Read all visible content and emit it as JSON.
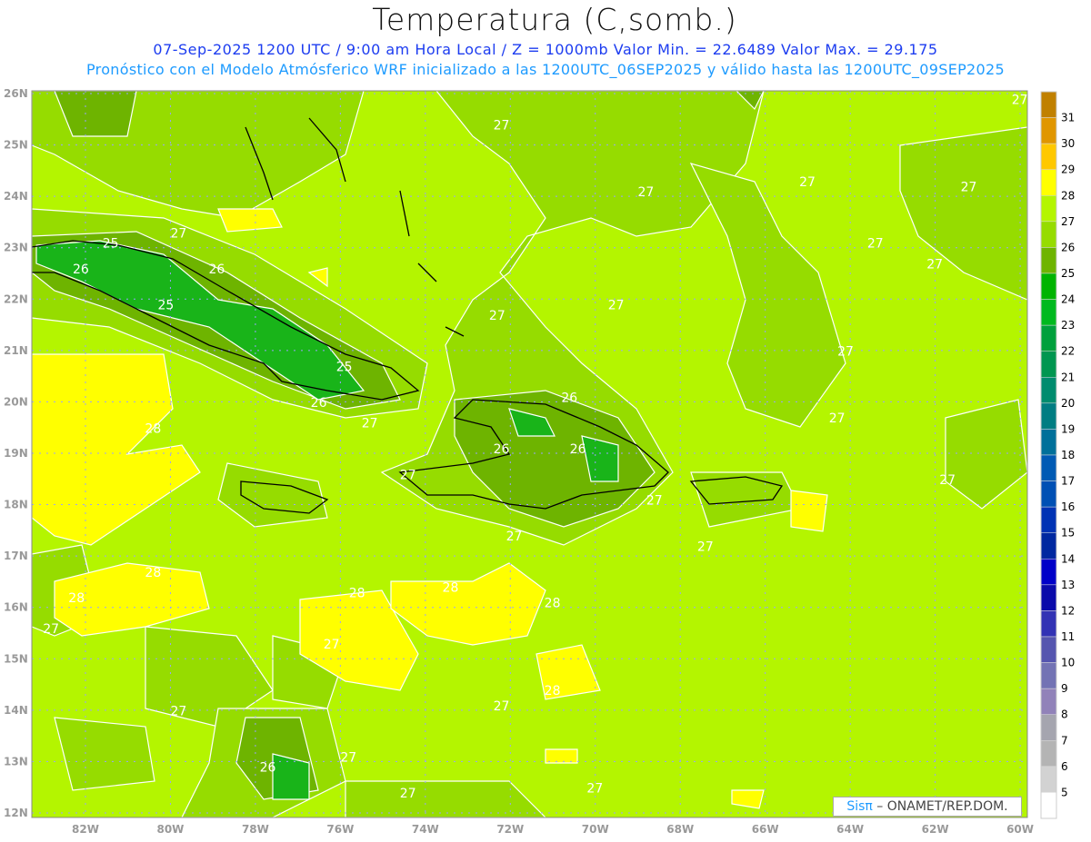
{
  "header": {
    "title": "Temperatura (C,somb.)",
    "subtitle_line1": "07-Sep-2025  1200 UTC / 9:00 am Hora Local / Z = 1000mb    Valor Min. = 22.6489  Valor Max. = 29.175",
    "subtitle_line2": "Pronóstico con el Modelo Atmósferico WRF inicializado a las 1200UTC_06SEP2025 y válido hasta las  1200UTC_09SEP2025"
  },
  "map": {
    "lat_ticks": [
      "26N",
      "25N",
      "24N",
      "23N",
      "22N",
      "21N",
      "20N",
      "19N",
      "18N",
      "17N",
      "16N",
      "15N",
      "14N",
      "13N",
      "12N"
    ],
    "lon_ticks": [
      "82W",
      "80W",
      "78W",
      "76W",
      "74W",
      "72W",
      "70W",
      "68W",
      "66W",
      "64W",
      "62W",
      "60W"
    ],
    "contour_labels": [
      {
        "t": "27",
        "lon": -72.4,
        "lat": 25.3
      },
      {
        "t": "27",
        "lon": -69.0,
        "lat": 24.0
      },
      {
        "t": "27",
        "lon": -65.2,
        "lat": 24.2
      },
      {
        "t": "27",
        "lon": -60.2,
        "lat": 25.8
      },
      {
        "t": "27",
        "lon": -61.4,
        "lat": 24.1
      },
      {
        "t": "27",
        "lon": -63.6,
        "lat": 23.0
      },
      {
        "t": "27",
        "lon": -62.2,
        "lat": 22.6
      },
      {
        "t": "27",
        "lon": -80.0,
        "lat": 23.2
      },
      {
        "t": "25",
        "lon": -81.6,
        "lat": 23.0
      },
      {
        "t": "26",
        "lon": -82.3,
        "lat": 22.5
      },
      {
        "t": "26",
        "lon": -79.1,
        "lat": 22.5
      },
      {
        "t": "25",
        "lon": -80.3,
        "lat": 21.8
      },
      {
        "t": "27",
        "lon": -72.5,
        "lat": 21.6
      },
      {
        "t": "27",
        "lon": -69.7,
        "lat": 21.8
      },
      {
        "t": "27",
        "lon": -64.3,
        "lat": 20.9
      },
      {
        "t": "25",
        "lon": -76.1,
        "lat": 20.6
      },
      {
        "t": "26",
        "lon": -76.7,
        "lat": 19.9
      },
      {
        "t": "27",
        "lon": -75.5,
        "lat": 19.5
      },
      {
        "t": "26",
        "lon": -70.8,
        "lat": 20.0
      },
      {
        "t": "27",
        "lon": -64.5,
        "lat": 19.6
      },
      {
        "t": "28",
        "lon": -80.6,
        "lat": 19.4
      },
      {
        "t": "26",
        "lon": -72.4,
        "lat": 19.0
      },
      {
        "t": "26",
        "lon": -70.6,
        "lat": 19.0
      },
      {
        "t": "27",
        "lon": -74.6,
        "lat": 18.5
      },
      {
        "t": "27",
        "lon": -61.9,
        "lat": 18.4
      },
      {
        "t": "27",
        "lon": -68.8,
        "lat": 18.0
      },
      {
        "t": "27",
        "lon": -72.1,
        "lat": 17.3
      },
      {
        "t": "27",
        "lon": -67.6,
        "lat": 17.1
      },
      {
        "t": "28",
        "lon": -80.6,
        "lat": 16.6
      },
      {
        "t": "28",
        "lon": -82.4,
        "lat": 16.1
      },
      {
        "t": "28",
        "lon": -75.8,
        "lat": 16.2
      },
      {
        "t": "28",
        "lon": -73.6,
        "lat": 16.3
      },
      {
        "t": "28",
        "lon": -71.2,
        "lat": 16.0
      },
      {
        "t": "27",
        "lon": -83.0,
        "lat": 15.5
      },
      {
        "t": "27",
        "lon": -76.4,
        "lat": 15.2
      },
      {
        "t": "28",
        "lon": -71.2,
        "lat": 14.3
      },
      {
        "t": "27",
        "lon": -72.4,
        "lat": 14.0
      },
      {
        "t": "27",
        "lon": -80.0,
        "lat": 13.9
      },
      {
        "t": "27",
        "lon": -76.0,
        "lat": 13.0
      },
      {
        "t": "26",
        "lon": -77.9,
        "lat": 12.8
      },
      {
        "t": "27",
        "lon": -74.6,
        "lat": 12.3
      },
      {
        "t": "27",
        "lon": -70.2,
        "lat": 12.4
      }
    ]
  },
  "colorbar": {
    "labels": [
      "31",
      "30",
      "29",
      "28",
      "27",
      "26",
      "25",
      "24",
      "23",
      "22",
      "21",
      "20",
      "19",
      "18",
      "17",
      "16",
      "15",
      "14",
      "13",
      "12",
      "11",
      "10",
      "9",
      "8",
      "7",
      "6",
      "5"
    ],
    "colors": [
      "#c08000",
      "#e09600",
      "#ffc800",
      "#ffff00",
      "#b4f500",
      "#96dc00",
      "#6eb400",
      "#00b400",
      "#00b91e",
      "#00a03c",
      "#009650",
      "#008c6e",
      "#007d82",
      "#00709a",
      "#005ab4",
      "#0050b4",
      "#0032b4",
      "#0028a0",
      "#0000c8",
      "#0a0aaa",
      "#3232b4",
      "#5555af",
      "#7373b4",
      "#9182b9",
      "#a5a5af",
      "#b4b4b4",
      "#d2d2d2",
      "#ffffff"
    ]
  },
  "credit": {
    "brand": "Sisπ",
    "text": " –  ONAMET/REP.DOM."
  }
}
